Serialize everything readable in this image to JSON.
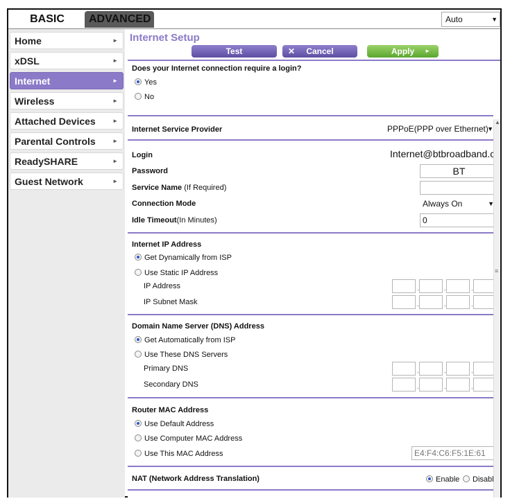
{
  "tabs": {
    "basic": "BASIC",
    "advanced": "ADVANCED"
  },
  "top_select": {
    "value": "Auto"
  },
  "sidebar": {
    "items": [
      {
        "label": "Home"
      },
      {
        "label": "xDSL"
      },
      {
        "label": "Internet"
      },
      {
        "label": "Wireless"
      },
      {
        "label": "Attached Devices"
      },
      {
        "label": "Parental Controls"
      },
      {
        "label": "ReadySHARE"
      },
      {
        "label": "Guest Network"
      }
    ],
    "active": "Internet"
  },
  "page": {
    "title": "Internet Setup",
    "buttons": {
      "test": "Test",
      "cancel": "Cancel",
      "apply": "Apply"
    }
  },
  "login_required": {
    "question": "Does your Internet connection require a login?",
    "yes": "Yes",
    "no": "No",
    "selected": "Yes"
  },
  "isp": {
    "label": "Internet Service Provider",
    "value": "PPPoE(PPP over Ethernet)"
  },
  "login": {
    "label": "Login",
    "value": "Internet@btbroadband.com"
  },
  "password": {
    "label": "Password",
    "value": "BT"
  },
  "service_name": {
    "label": "Service Name",
    "hint": "(If Required)",
    "value": ""
  },
  "connection_mode": {
    "label": "Connection Mode",
    "value": "Always On"
  },
  "idle_timeout": {
    "label": "Idle Timeout",
    "hint": "(In Minutes)",
    "value": "0"
  },
  "ip_address_section": {
    "title": "Internet IP Address",
    "dynamic": "Get Dynamically from ISP",
    "static": "Use Static IP Address",
    "selected": "dynamic",
    "ip_label": "IP Address",
    "mask_label": "IP Subnet Mask"
  },
  "dns_section": {
    "title": "Domain Name Server (DNS) Address",
    "auto": "Get Automatically from ISP",
    "manual": "Use These DNS Servers",
    "selected": "auto",
    "primary_label": "Primary DNS",
    "secondary_label": "Secondary DNS"
  },
  "mac_section": {
    "title": "Router MAC Address",
    "default": "Use Default Address",
    "computer": "Use Computer MAC Address",
    "this": "Use This MAC Address",
    "selected": "default",
    "mac_value": "E4:F4:C6:F5:1E:61"
  },
  "nat": {
    "label": "NAT (Network Address Translation)",
    "enable": "Enable",
    "disable": "Disable",
    "selected": "Enable"
  },
  "colors": {
    "accent": "#8b7ac8",
    "apply": "#6bb43a",
    "tab_dark": "#5a5a5a"
  }
}
